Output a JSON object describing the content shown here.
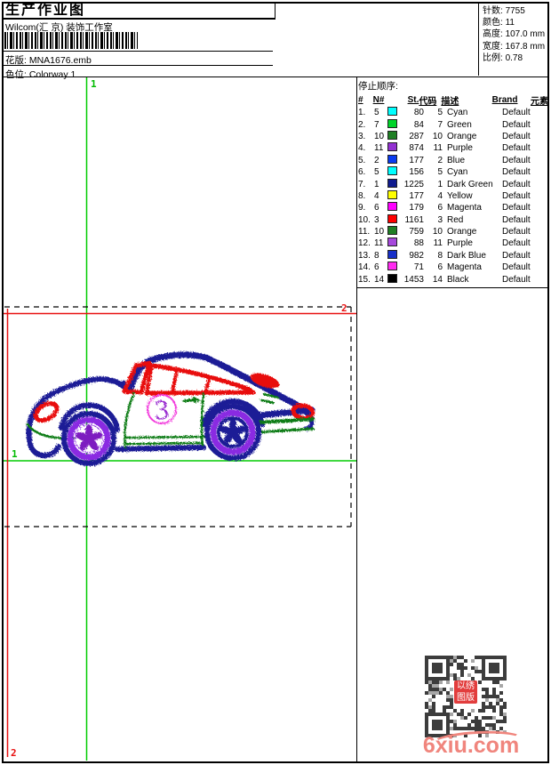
{
  "header": {
    "title": "生产作业图",
    "studio": "Wilcom(汇 京) 装饰工作室",
    "pattern_label": "花版:",
    "pattern_value": "MNA1676.emb",
    "colorway_label": "色位:",
    "colorway_value": "Colorway 1"
  },
  "info": {
    "rows": [
      {
        "label": "针数:",
        "value": "7755"
      },
      {
        "label": "颜色:",
        "value": "11"
      },
      {
        "label": "高度:",
        "value": "107.0 mm"
      },
      {
        "label": "宽度:",
        "value": "167.8 mm"
      },
      {
        "label": "比例:",
        "value": "0.78"
      }
    ]
  },
  "stop_table": {
    "title": "停止顺序:",
    "columns": [
      "#",
      "N#",
      "St.",
      "代码",
      "描述",
      "Brand",
      "元素"
    ],
    "rows": [
      {
        "idx": "1.",
        "n": "5",
        "color": "#00FFFF",
        "st": "80",
        "code": "5",
        "desc": "Cyan",
        "brand": "Default"
      },
      {
        "idx": "2.",
        "n": "7",
        "color": "#00D42A",
        "st": "84",
        "code": "7",
        "desc": "Green",
        "brand": "Default"
      },
      {
        "idx": "3.",
        "n": "10",
        "color": "#1F7F24",
        "st": "287",
        "code": "10",
        "desc": "Orange",
        "brand": "Default"
      },
      {
        "idx": "4.",
        "n": "11",
        "color": "#9331D1",
        "st": "874",
        "code": "11",
        "desc": "Purple",
        "brand": "Default"
      },
      {
        "idx": "5.",
        "n": "2",
        "color": "#0A3BF0",
        "st": "177",
        "code": "2",
        "desc": "Blue",
        "brand": "Default"
      },
      {
        "idx": "6.",
        "n": "5",
        "color": "#00FFFF",
        "st": "156",
        "code": "5",
        "desc": "Cyan",
        "brand": "Default"
      },
      {
        "idx": "7.",
        "n": "1",
        "color": "#101C8F",
        "st": "1225",
        "code": "1",
        "desc": "Dark Green",
        "brand": "Default"
      },
      {
        "idx": "8.",
        "n": "4",
        "color": "#FFFF00",
        "st": "177",
        "code": "4",
        "desc": "Yellow",
        "brand": "Default"
      },
      {
        "idx": "9.",
        "n": "6",
        "color": "#FF00FF",
        "st": "179",
        "code": "6",
        "desc": "Magenta",
        "brand": "Default"
      },
      {
        "idx": "10.",
        "n": "3",
        "color": "#FF0000",
        "st": "1161",
        "code": "3",
        "desc": "Red",
        "brand": "Default"
      },
      {
        "idx": "11.",
        "n": "10",
        "color": "#1F7F24",
        "st": "759",
        "code": "10",
        "desc": "Orange",
        "brand": "Default"
      },
      {
        "idx": "12.",
        "n": "11",
        "color": "#A648DC",
        "st": "88",
        "code": "11",
        "desc": "Purple",
        "brand": "Default"
      },
      {
        "idx": "13.",
        "n": "8",
        "color": "#1830C8",
        "st": "982",
        "code": "8",
        "desc": "Dark Blue",
        "brand": "Default"
      },
      {
        "idx": "14.",
        "n": "6",
        "color": "#FF2BF0",
        "st": "71",
        "code": "6",
        "desc": "Magenta",
        "brand": "Default"
      },
      {
        "idx": "15.",
        "n": "14",
        "color": "#000000",
        "st": "1453",
        "code": "14",
        "desc": "Black",
        "brand": "Default"
      }
    ]
  },
  "guides": {
    "label1": "1",
    "label2": "2",
    "green": "#00CC00",
    "red": "#E81111"
  },
  "design": {
    "number_label": "3"
  },
  "watermark": {
    "site": "6xiu.com",
    "seal_text": "以绣图版"
  }
}
